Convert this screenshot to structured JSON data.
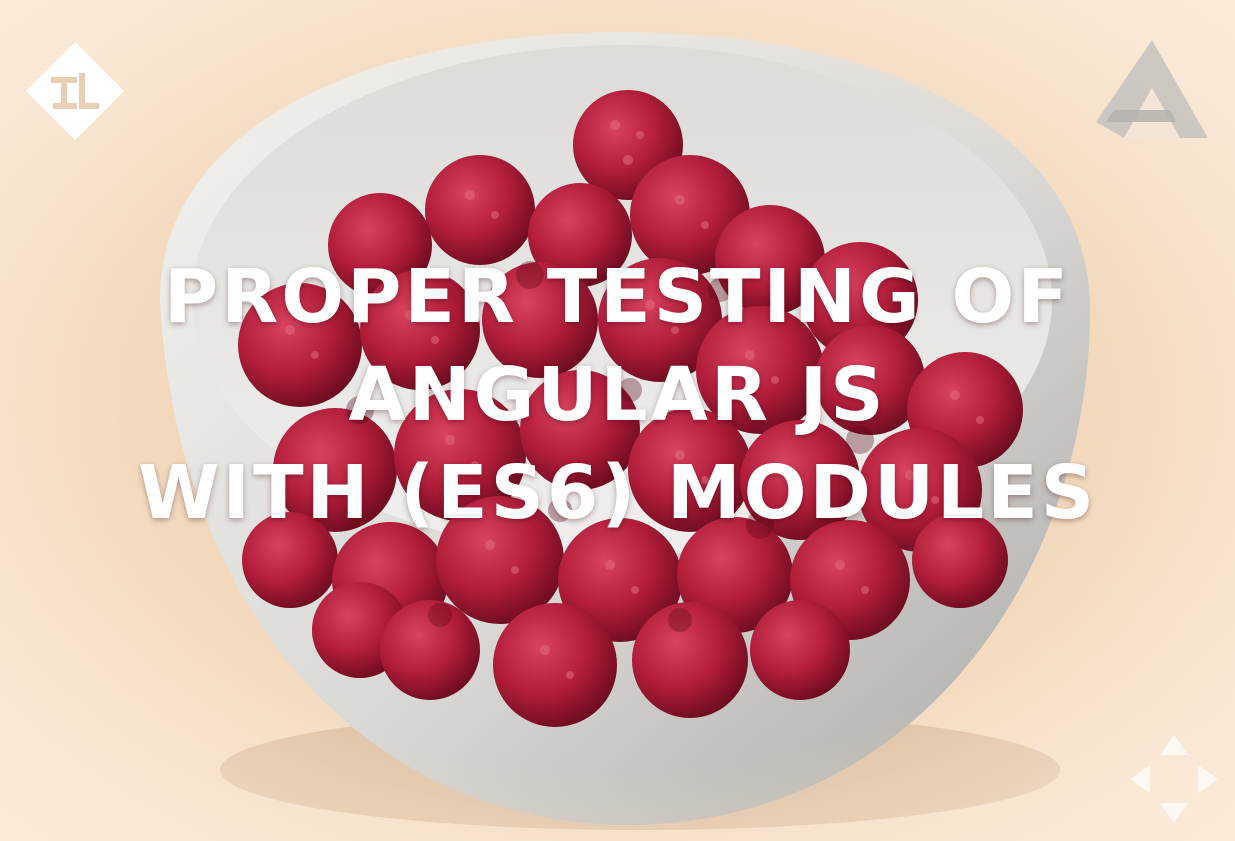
{
  "image": {
    "subject": "white bowl filled with raspberries",
    "colors": {
      "background": "#f6dfc4",
      "bowl": "#e7e7e4",
      "bowl_shadow": "#b9b8b4",
      "raspberry": "#b3203c",
      "raspberry_dark": "#6d0d20",
      "title_text": "#ffffff",
      "logo_white": "#ffffff",
      "logo_grey": "#bdbdbd"
    }
  },
  "title": {
    "lines": [
      "PROPER TESTING OF",
      "ANGULAR JS",
      "WITH (ES6) MODULES"
    ]
  },
  "logos": {
    "left": {
      "icon": "tl-diamond-logo-icon",
      "text": "TL"
    },
    "right": {
      "icon": "triangle-logo-icon"
    },
    "bottom_right": {
      "icon": "arrow-cluster-watermark-icon"
    }
  }
}
